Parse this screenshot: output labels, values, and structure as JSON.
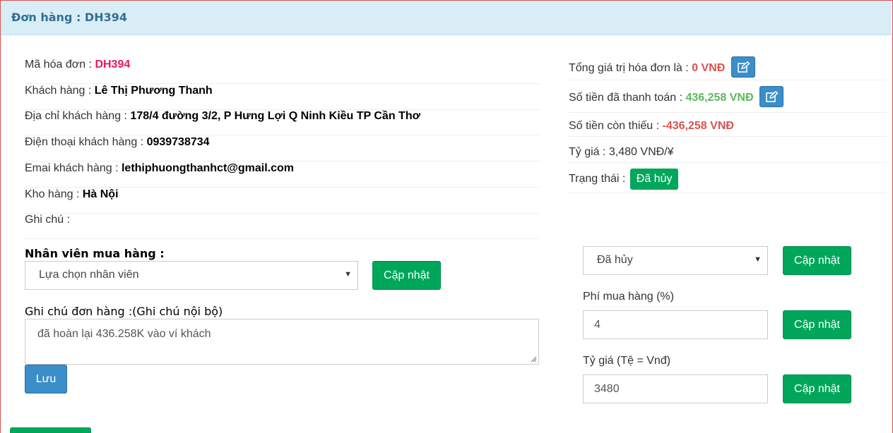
{
  "header": {
    "title": "Đơn hàng : DH394"
  },
  "order_info": {
    "invoice_code_label": "Mã hóa đơn : ",
    "invoice_code": "DH394",
    "customer_label": "Khách hàng : ",
    "customer": "Lê Thị Phương Thanh",
    "address_label": "Địa chỉ khách hàng : ",
    "address": "178/4 đường 3/2, P Hưng Lợi Q Ninh Kiều TP Cần Thơ",
    "phone_label": "Điện thoại khách hàng : ",
    "phone": "0939738734",
    "email_label": "Emai khách hàng : ",
    "email": "lethiphuongthanhct@gmail.com",
    "warehouse_label": "Kho hàng : ",
    "warehouse": "Hà Nội",
    "note_label": "Ghi chú :"
  },
  "summary": {
    "total_label": "Tổng giá trị hóa đơn là : ",
    "total": "0 VNĐ",
    "paid_label": "Số tiền đã thanh toán : ",
    "paid": "436,258 VNĐ",
    "remaining_label": "Số tiền còn thiếu : ",
    "remaining": "-436,258 VNĐ",
    "rate_label": "Tỷ giá : 3,480 VNĐ/¥",
    "status_label": "Trạng thái : ",
    "status": "Đã hủy",
    "colors": {
      "red": "#d9534f",
      "green": "#5cb85c",
      "badge": "#00a65a"
    }
  },
  "staff": {
    "label": "Nhân viên mua hàng :",
    "select_value": "Lựa chọn nhân viên",
    "update_label": "Cập nhật"
  },
  "internal_note": {
    "label": "Ghi chú đơn hàng :(Ghi chú nội bộ)",
    "value": "đã hoàn lại 436.258K vào ví khách",
    "save_label": "Lưu"
  },
  "status_form": {
    "select_value": "Đã hủy",
    "update_label": "Cập nhật",
    "fee_label": "Phí mua hàng (%)",
    "fee_value": "4",
    "fee_update_label": "Cập nhật",
    "rate_label": "Tỷ giá (Tệ = Vnđ)",
    "rate_value": "3480",
    "rate_update_label": "Cập nhật"
  }
}
